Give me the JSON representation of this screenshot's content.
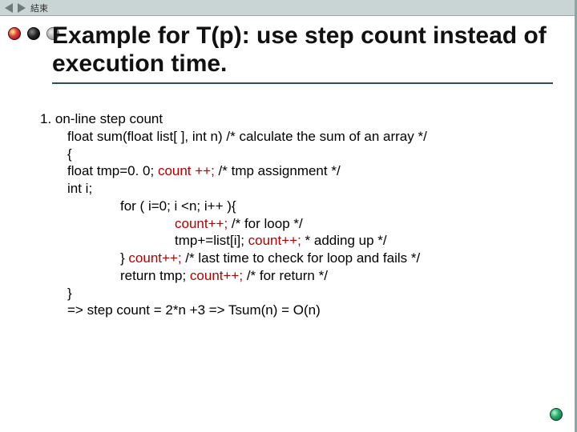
{
  "topbar": {
    "end_label": "結束"
  },
  "title": "Example for T(p): use step count instead of execution time.",
  "body": {
    "h1": "1. on-line step count",
    "sig": "float sum(float list[ ], int n)  /* calculate the sum of an array */",
    "brace_open": "{",
    "tmp_a": "float tmp=0. 0; ",
    "count1": "count ++;",
    "tmp_c": "          /* tmp assignment */",
    "inti": "int i;",
    "forhead": "for ( i=0; i <n; i++ ){",
    "c2a": "count++;",
    "c2b": "             /* for loop */",
    "add_a": "tmp+=list[i];   ",
    "add_b": "count++;",
    "add_c": "   * adding up */",
    "last_pre": "}          ",
    "last_b": "count++;",
    "last_c": " /* last time to check for loop and fails */",
    "ret_a": "return tmp;   ",
    "ret_b": "count++;",
    "ret_c": "      /* for return */",
    "brace_close": "}",
    "result": "=> step count = 2*n +3  => Tsum(n) = O(n)"
  }
}
